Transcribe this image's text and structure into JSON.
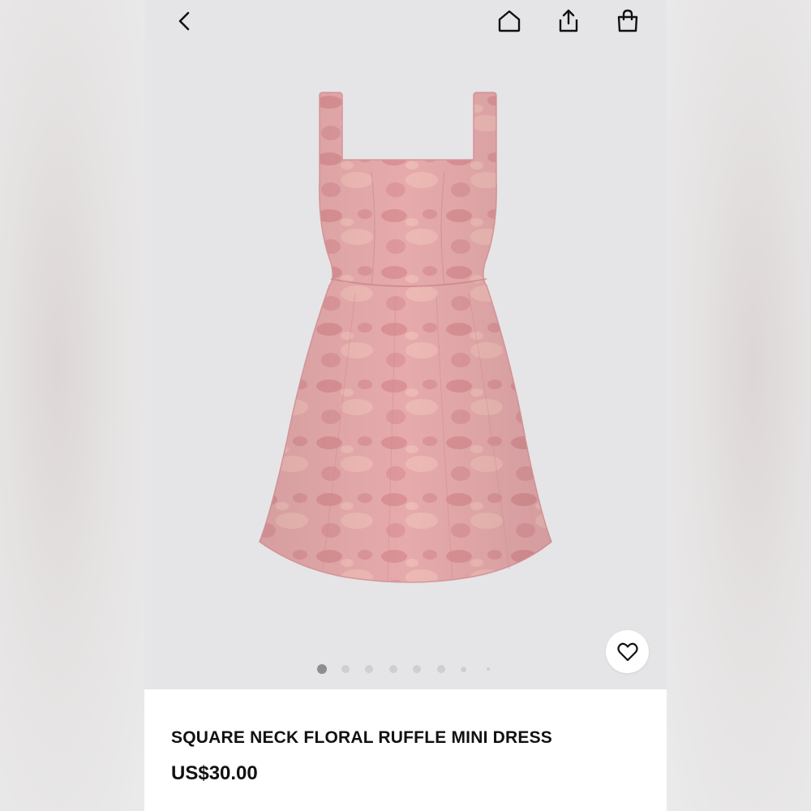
{
  "header": {
    "icons": [
      "chevron-left-icon",
      "home-icon",
      "share-icon",
      "shopping-bag-icon"
    ]
  },
  "gallery": {
    "image": "pink-square-neck-dress-image",
    "slide_count": 8,
    "active_index": 0
  },
  "product": {
    "title": "SQUARE NECK FLORAL RUFFLE MINI DRESS",
    "price": "US$30.00"
  },
  "colors": {
    "background": "#e5e5e7",
    "dress": "#e3a6a9",
    "text": "#111111"
  }
}
